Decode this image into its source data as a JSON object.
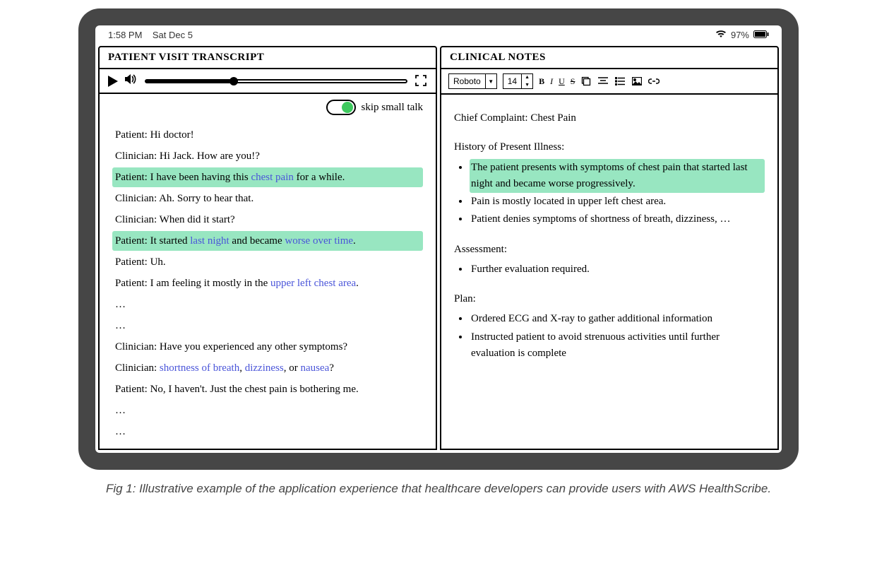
{
  "statusbar": {
    "time": "1:58 PM",
    "date": "Sat Dec 5",
    "battery": "97%"
  },
  "left_panel": {
    "title": "PATIENT VISIT TRANSCRIPT",
    "skip_label": "skip small talk",
    "lines": {
      "l0": {
        "speaker": "Patient",
        "text": "Hi doctor!"
      },
      "l1": {
        "speaker": "Clinician",
        "text": "Hi Jack. How are you!?"
      },
      "l2": {
        "speaker": "Patient",
        "pre": "I have been having this ",
        "kw": "chest pain",
        "post": " for a while."
      },
      "l3": {
        "speaker": "Clinician",
        "text": "Ah. Sorry to hear that."
      },
      "l4": {
        "speaker": "Clinician",
        "text": "When did it start?"
      },
      "l5": {
        "speaker": "Patient",
        "pre": "It started ",
        "kw1": "last night",
        "mid": " and became ",
        "kw2": "worse over time",
        "post": "."
      },
      "l6": {
        "speaker": "Patient",
        "text": "Uh."
      },
      "l7": {
        "speaker": "Patient",
        "pre": "I am feeling it mostly in the ",
        "kw": "upper left chest area",
        "post": "."
      },
      "l8": {
        "text": "…"
      },
      "l9": {
        "text": "…"
      },
      "l10": {
        "speaker": "Clinician",
        "text": "Have you experienced any other symptoms?"
      },
      "l11": {
        "speaker": "Clinician",
        "kw1": "shortness of breath",
        "sep1": ", ",
        "kw2": "dizziness",
        "sep2": ", or ",
        "kw3": "nausea",
        "post": "?"
      },
      "l12": {
        "speaker": "Patient",
        "text": "No, I haven't. Just the chest pain is bothering me."
      },
      "l13": {
        "text": "…"
      },
      "l14": {
        "text": "…"
      }
    }
  },
  "right_panel": {
    "title": "CLINICAL NOTES",
    "toolbar": {
      "font": "Roboto",
      "size": "14"
    },
    "chief_label": "Chief Complaint: Chest Pain",
    "hpi_label": "History of Present Illness:",
    "hpi": {
      "i0": "The patient presents with symptoms of chest pain that started last night and became worse progressively.",
      "i1": "Pain is mostly located in upper left chest area.",
      "i2": "Patient denies symptoms of shortness of breath, dizziness, …"
    },
    "assessment_label": "Assessment:",
    "assessment": {
      "i0": "Further evaluation required."
    },
    "plan_label": "Plan:",
    "plan": {
      "i0": "Ordered ECG and X-ray to gather additional information",
      "i1": "Instructed patient to avoid strenuous activities until further evaluation is complete"
    }
  },
  "caption": "Fig 1: Illustrative example of the application experience that healthcare developers can provide users with AWS HealthScribe."
}
